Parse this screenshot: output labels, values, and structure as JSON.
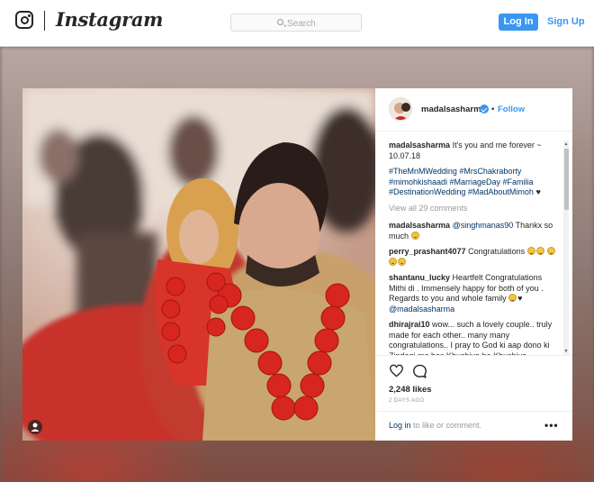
{
  "header": {
    "wordmark": "Instagram",
    "search_placeholder": "Search",
    "login_label": "Log In",
    "signup_label": "Sign Up",
    "accent_color": "#3897f0"
  },
  "post": {
    "username": "madalsasharma",
    "follow_label": "Follow",
    "dot": "•",
    "caption": {
      "user": "madalsasharma",
      "text": "It's you and me forever ~ 10.07.18",
      "hashtags": "#TheMnMWedding #MrsChakraborty #mimohkishaadi #MarriageDay #Familia #DestinationWedding #MadAboutMimoh",
      "heart": "♥"
    },
    "view_all": "View all 29 comments",
    "comments": [
      {
        "user": "madalsasharma",
        "mention": "@singhmanas90",
        "text": "Thankx so much"
      },
      {
        "user": "perry_prashant4077",
        "text": "Congratulations"
      },
      {
        "user": "shantanu_lucky",
        "text": "Heartfelt Congratulations Mithi di . Immensely happy for both of you . Regards to you and whole family",
        "mention": "@madalsasharma",
        "heart": "♥"
      },
      {
        "user": "dhirajrai10",
        "text": "wow... such a lovely couple.. truly made for each other.. many many congratulations.. I pray to God ki aap dono ki Zindagi me bas Khushiya he Khushiya"
      }
    ],
    "likes": "2,248 likes",
    "time": "2 DAYS AGO",
    "login_link": "Log in",
    "login_suffix": " to like or comment.",
    "more": "•••"
  }
}
